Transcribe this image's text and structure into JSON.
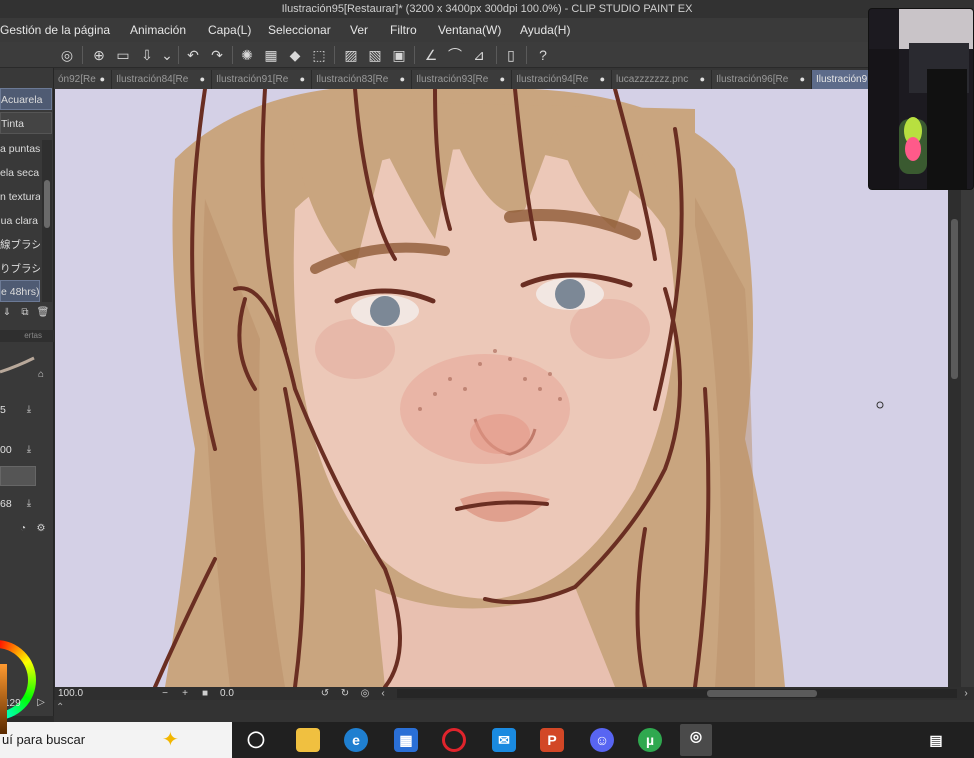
{
  "window": {
    "title": "Ilustración95[Restaurar]* (3200 x 3400px 300dpi 100.0%)  - CLIP STUDIO PAINT EX"
  },
  "menu": [
    "Gestión de la página",
    "Animación",
    "Capa(L)",
    "Seleccionar",
    "Ver",
    "Filtro",
    "Ventana(W)",
    "Ayuda(H)"
  ],
  "tabs": [
    {
      "label": "ón92[Re",
      "active": false
    },
    {
      "label": "Ilustración84[Re",
      "active": false
    },
    {
      "label": "Ilustración91[Re",
      "active": false
    },
    {
      "label": "Ilustración83[Re",
      "active": false
    },
    {
      "label": "Ilustración93[Re",
      "active": false
    },
    {
      "label": "Ilustración94[Re",
      "active": false
    },
    {
      "label": "lucazzzzzzz.pnc",
      "active": false
    },
    {
      "label": "Ilustración96[Re",
      "active": false
    },
    {
      "label": "Ilustración9",
      "active": true
    }
  ],
  "left_panel": {
    "category_tabs": [
      "Acuarela",
      "Tinta"
    ],
    "brushes": [
      "a puntas",
      "ela seca",
      "n textura",
      "ua clara",
      "線ブラシ",
      "りブラシ",
      "e 48hrs)"
    ],
    "field_values": [
      "5",
      "00",
      "68"
    ],
    "color_value": "129",
    "panel_tab_partial": "ertas"
  },
  "status": {
    "zoom": "100.0",
    "angle": "0.0"
  },
  "taskbar": {
    "search_placeholder": "uí para buscar",
    "apps": [
      "task-view",
      "file-explorer",
      "edge",
      "microsoft-store",
      "opera",
      "mail",
      "powerpoint",
      "discord",
      "utorrent",
      "clip-studio-paint"
    ]
  },
  "colors": {
    "canvas_bg": "#d4d0e6",
    "active_tab": "#5d6b8a",
    "hair": "#c9a57f",
    "skin": "#ecc8b8",
    "line": "#6a2e22"
  }
}
